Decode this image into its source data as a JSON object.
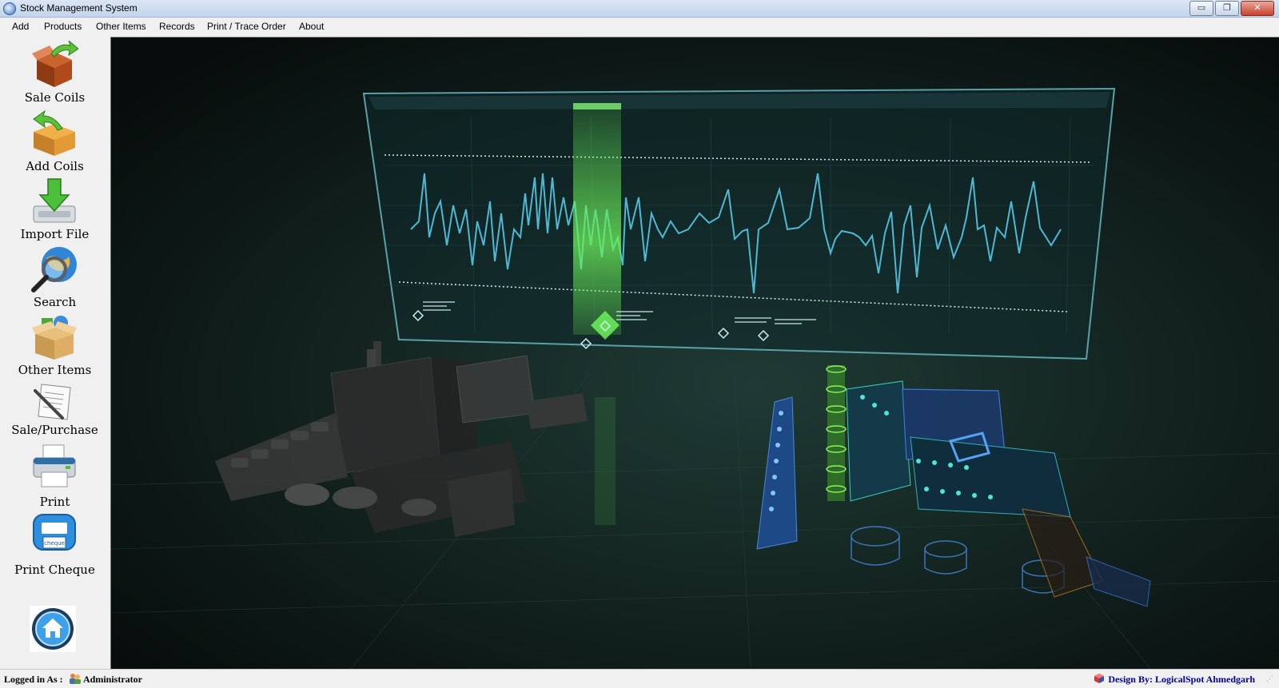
{
  "window": {
    "title": "Stock Management System",
    "minimize": "▭",
    "restore": "❐",
    "close": "✕"
  },
  "menu": [
    "Add",
    "Products",
    "Other Items",
    "Records",
    "Print / Trace Order",
    "About"
  ],
  "sidebar": {
    "items": [
      {
        "label": "Sale Coils",
        "icon": "box-out-icon"
      },
      {
        "label": "Add Coils",
        "icon": "box-in-icon"
      },
      {
        "label": "Import File",
        "icon": "download-icon"
      },
      {
        "label": "Search",
        "icon": "search-globe-icon"
      },
      {
        "label": "Other Items",
        "icon": "open-box-icon"
      },
      {
        "label": "Sale/Purchase",
        "icon": "document-pen-icon"
      },
      {
        "label": "Print",
        "icon": "printer-icon"
      },
      {
        "label": "Print Cheque",
        "icon": "cheque-printer-icon"
      }
    ],
    "home_icon": "home-icon",
    "cheque_caption": "cheque"
  },
  "status": {
    "logged_in_label": "Logged in As :",
    "user": "Administrator",
    "credit": "Design By: LogicalSpot Ahmedgarh"
  },
  "colors": {
    "accent_cyan": "#4fb8d4",
    "accent_green": "#6cf25a",
    "background_dark": "#0e1a18",
    "credit_text": "#0000a0"
  }
}
